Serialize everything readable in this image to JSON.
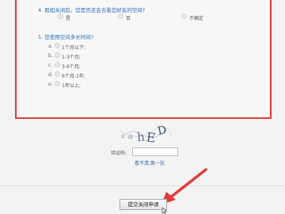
{
  "q4": {
    "title": "4. 假如关闭后，您是否还会去看您好友的空间?",
    "options": [
      "是",
      "否",
      "不确定"
    ]
  },
  "q5": {
    "title": "5. 您使用空间多长时间?",
    "options": [
      {
        "letter": "a.",
        "label": "1个月以下;"
      },
      {
        "letter": "b.",
        "label": "1-3个月;"
      },
      {
        "letter": "c.",
        "label": "3-6个月;"
      },
      {
        "letter": "d.",
        "label": "6个月-1年;"
      },
      {
        "letter": "e.",
        "label": "1年以上;"
      }
    ]
  },
  "captcha": {
    "label": "验证码:",
    "input_value": "",
    "refresh_link": "看不清,换一张",
    "image_text": "xahED"
  },
  "submit": {
    "label": "提交关闭申请"
  },
  "colors": {
    "highlight_border": "#e23a3a",
    "link_blue": "#2d6db0",
    "arrow_red": "#e23a3a"
  }
}
